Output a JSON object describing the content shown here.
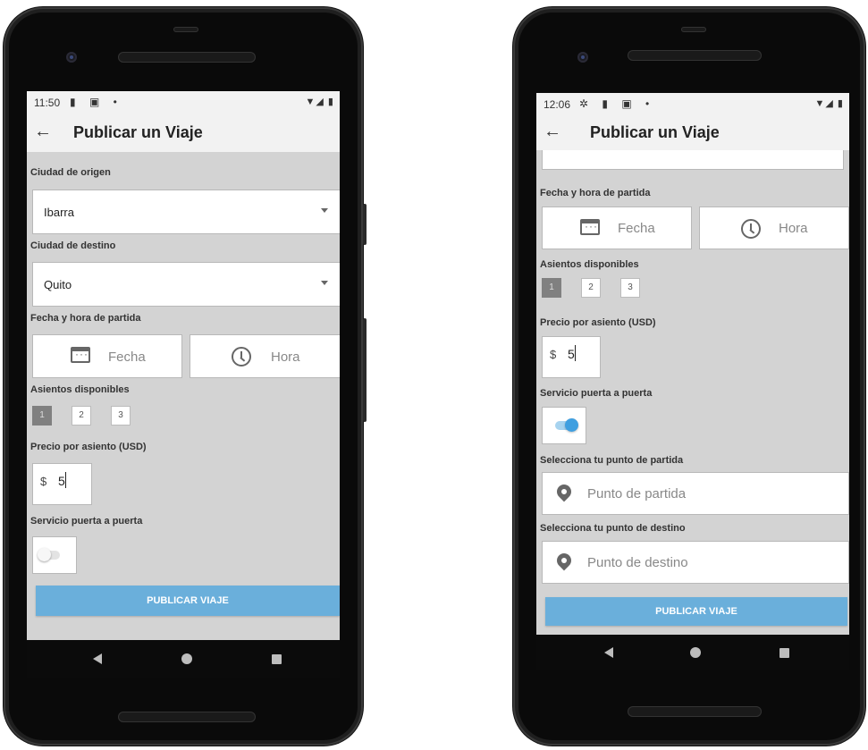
{
  "left": {
    "status": {
      "time": "11:50",
      "icons": "▮ ▣ •",
      "right_icons": "▼◢ ▮"
    },
    "appbar": {
      "back": "←",
      "title": "Publicar un Viaje"
    },
    "origin": {
      "label": "Ciudad de origen",
      "value": "Ibarra"
    },
    "destination": {
      "label": "Ciudad de destino",
      "value": "Quito"
    },
    "datetime": {
      "label": "Fecha y hora de partida",
      "date_btn": "Fecha",
      "time_btn": "Hora"
    },
    "seats": {
      "label": "Asientos disponibles",
      "options": [
        "1",
        "2",
        "3"
      ],
      "selected": "1"
    },
    "price": {
      "label": "Precio por asiento (USD)",
      "currency": "$",
      "value": "5"
    },
    "door": {
      "label": "Servicio puerta a puerta",
      "enabled": false
    },
    "publish": "PUBLICAR VIAJE"
  },
  "right": {
    "status": {
      "time": "12:06",
      "icons": "✲ ▮ ▣ •",
      "right_icons": "▼◢ ▮"
    },
    "appbar": {
      "back": "←",
      "title": "Publicar un Viaje"
    },
    "datetime": {
      "label": "Fecha y hora de partida",
      "date_btn": "Fecha",
      "time_btn": "Hora"
    },
    "seats": {
      "label": "Asientos disponibles",
      "options": [
        "1",
        "2",
        "3"
      ],
      "selected": "1"
    },
    "price": {
      "label": "Precio por asiento (USD)",
      "currency": "$",
      "value": "5"
    },
    "door": {
      "label": "Servicio puerta a puerta",
      "enabled": true
    },
    "start_point": {
      "label": "Selecciona tu punto de partida",
      "placeholder": "Punto de partida"
    },
    "end_point": {
      "label": "Selecciona tu punto de destino",
      "placeholder": "Punto de destino"
    },
    "publish": "PUBLICAR VIAJE"
  },
  "colors": {
    "accent": "#6aafdb",
    "toggle_on": "#3f9fe0",
    "screen_bg": "#d3d3d3",
    "phone_body": "#1f1f1f"
  }
}
